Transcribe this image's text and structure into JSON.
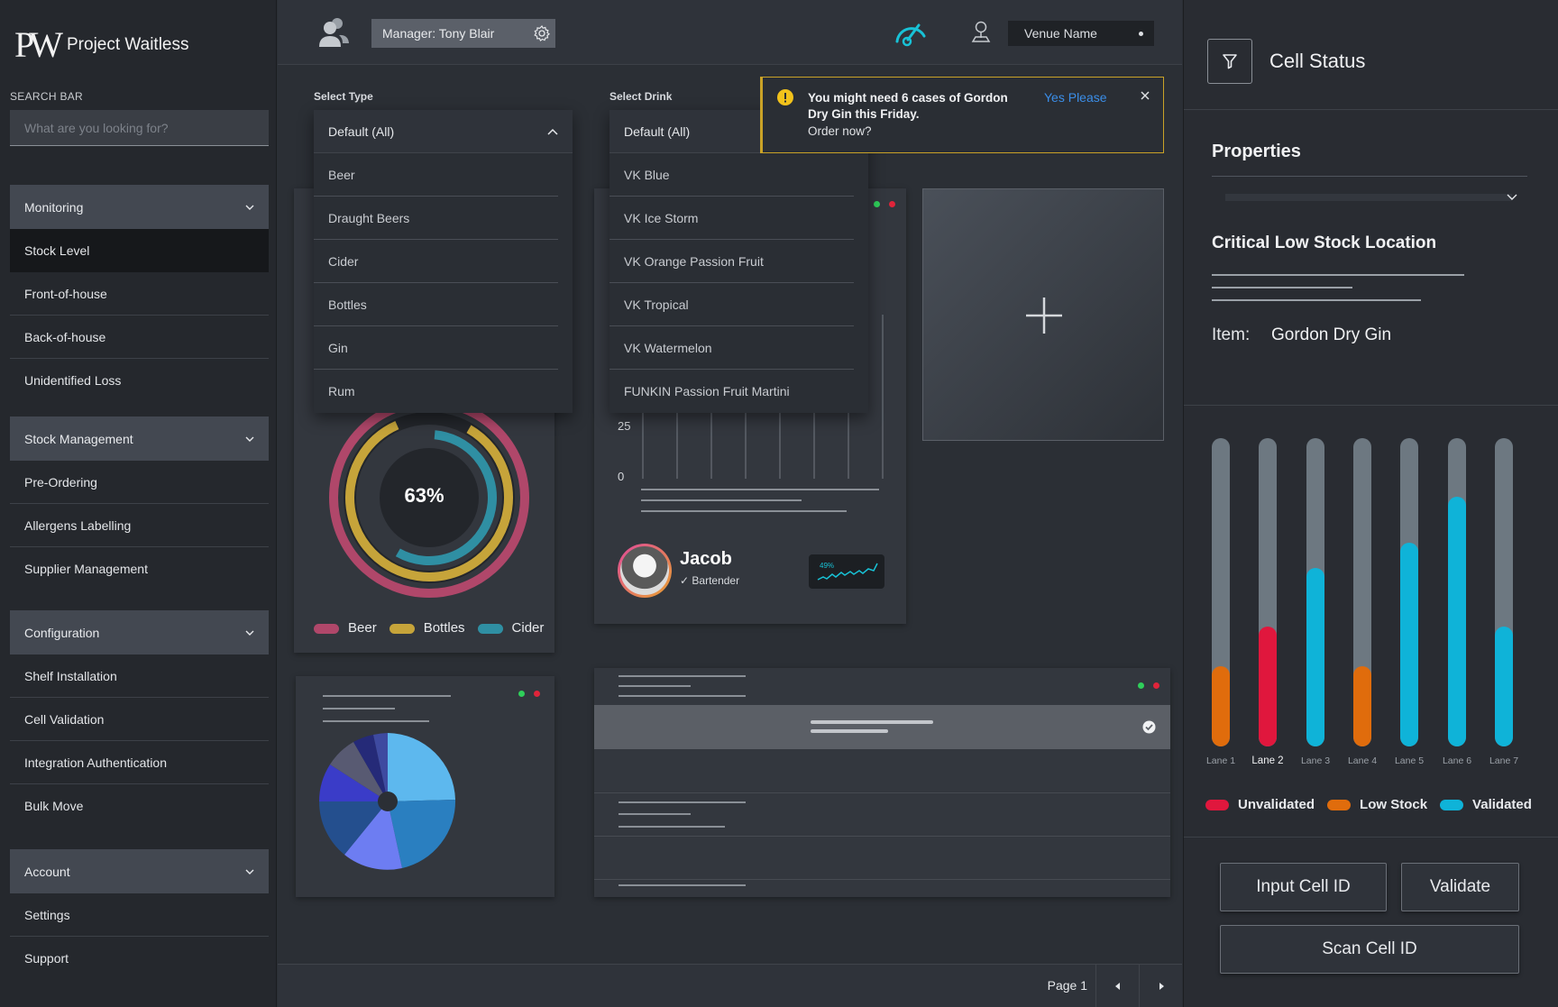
{
  "app": {
    "logo_mark": "PW",
    "name": "Project Waitless"
  },
  "search": {
    "label": "SEARCH BAR",
    "placeholder": "What are you looking for?"
  },
  "sidebar": {
    "groups": [
      {
        "title": "Monitoring",
        "items": [
          "Stock Level",
          "Front-of-house",
          "Back-of-house",
          "Unidentified Loss"
        ]
      },
      {
        "title": "Stock Management",
        "items": [
          "Pre-Ordering",
          "Allergens Labelling",
          "Supplier Management"
        ]
      },
      {
        "title": "Configuration",
        "items": [
          "Shelf Installation",
          "Cell Validation",
          "Integration Authentication",
          "Bulk Move"
        ]
      },
      {
        "title": "Account",
        "items": [
          "Settings",
          "Support"
        ]
      }
    ],
    "active_item": "Stock Level"
  },
  "topbar": {
    "manager": "Manager: Tony Blair",
    "venue": "Venue Name"
  },
  "filters": {
    "type": {
      "label": "Select Type",
      "selected": "Default (All)",
      "options": [
        "Beer",
        "Draught Beers",
        "Cider",
        "Bottles",
        "Gin",
        "Rum"
      ]
    },
    "drink": {
      "label": "Select Drink",
      "selected": "Default (All)",
      "options": [
        "VK Blue",
        "VK Ice Storm",
        "VK Orange Passion Fruit",
        "VK Tropical",
        "VK Watermelon",
        "FUNKIN Passion Fruit Martini"
      ]
    }
  },
  "alert": {
    "message": "You might need 6 cases of Gordon Dry Gin this Friday.",
    "sub": "Order now?",
    "action": "Yes Please"
  },
  "donut_card": {
    "center_label": "63%",
    "legend": [
      {
        "name": "Beer",
        "color": "#b0476a"
      },
      {
        "name": "Bottles",
        "color": "#c6a43a"
      },
      {
        "name": "Cider",
        "color": "#2f8fa3"
      }
    ]
  },
  "bar_card": {
    "y_ticks": [
      "25",
      "0"
    ],
    "person": {
      "name": "Jacob",
      "role": "Bartender",
      "stat": "49%"
    }
  },
  "right_panel": {
    "title": "Cell Status",
    "properties_title": "Properties",
    "critical_title": "Critical Low Stock Location",
    "item_label": "Item:",
    "item_value": "Gordon Dry Gin",
    "legend": [
      {
        "name": "Unvalidated",
        "color": "#e0173d"
      },
      {
        "name": "Low Stock",
        "color": "#e06c0c"
      },
      {
        "name": "Validated",
        "color": "#0fb3d8"
      }
    ],
    "buttons": {
      "input": "Input Cell ID",
      "validate": "Validate",
      "scan": "Scan Cell ID"
    }
  },
  "chart_data": {
    "type": "bar",
    "categories": [
      "Lane 1",
      "Lane 2",
      "Lane 3",
      "Lane 4",
      "Lane 5",
      "Lane 6",
      "Lane 7"
    ],
    "values": [
      26,
      39,
      58,
      26,
      66,
      81,
      39
    ],
    "statuses": [
      "Low Stock",
      "Unvalidated",
      "Validated",
      "Low Stock",
      "Validated",
      "Validated",
      "Validated"
    ],
    "colors": [
      "#e06c0c",
      "#e0173d",
      "#0fb3d8",
      "#e06c0c",
      "#0fb3d8",
      "#0fb3d8",
      "#0fb3d8"
    ],
    "ylim": [
      0,
      100
    ],
    "selected_category": "Lane 2"
  },
  "pager": {
    "label": "Page 1"
  }
}
